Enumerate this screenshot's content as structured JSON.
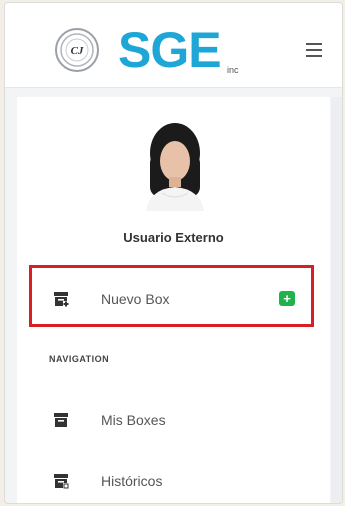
{
  "header": {
    "seal_text": "CJ",
    "logo_text": "SGE",
    "logo_sub": "inc"
  },
  "user": {
    "name": "Usuario Externo"
  },
  "menu": {
    "new_box_label": "Nuevo Box",
    "add_symbol": "+",
    "section_heading": "NAVIGATION",
    "items": [
      {
        "label": "Mis Boxes"
      },
      {
        "label": "Históricos"
      }
    ]
  },
  "colors": {
    "accent": "#1ea7d6",
    "highlight": "#d81e26",
    "add_button": "#22b24c"
  },
  "icons": {
    "menu": "hamburger-icon",
    "new_box": "archive-add-icon",
    "my_boxes": "archive-box-icon",
    "history": "archive-history-icon"
  }
}
